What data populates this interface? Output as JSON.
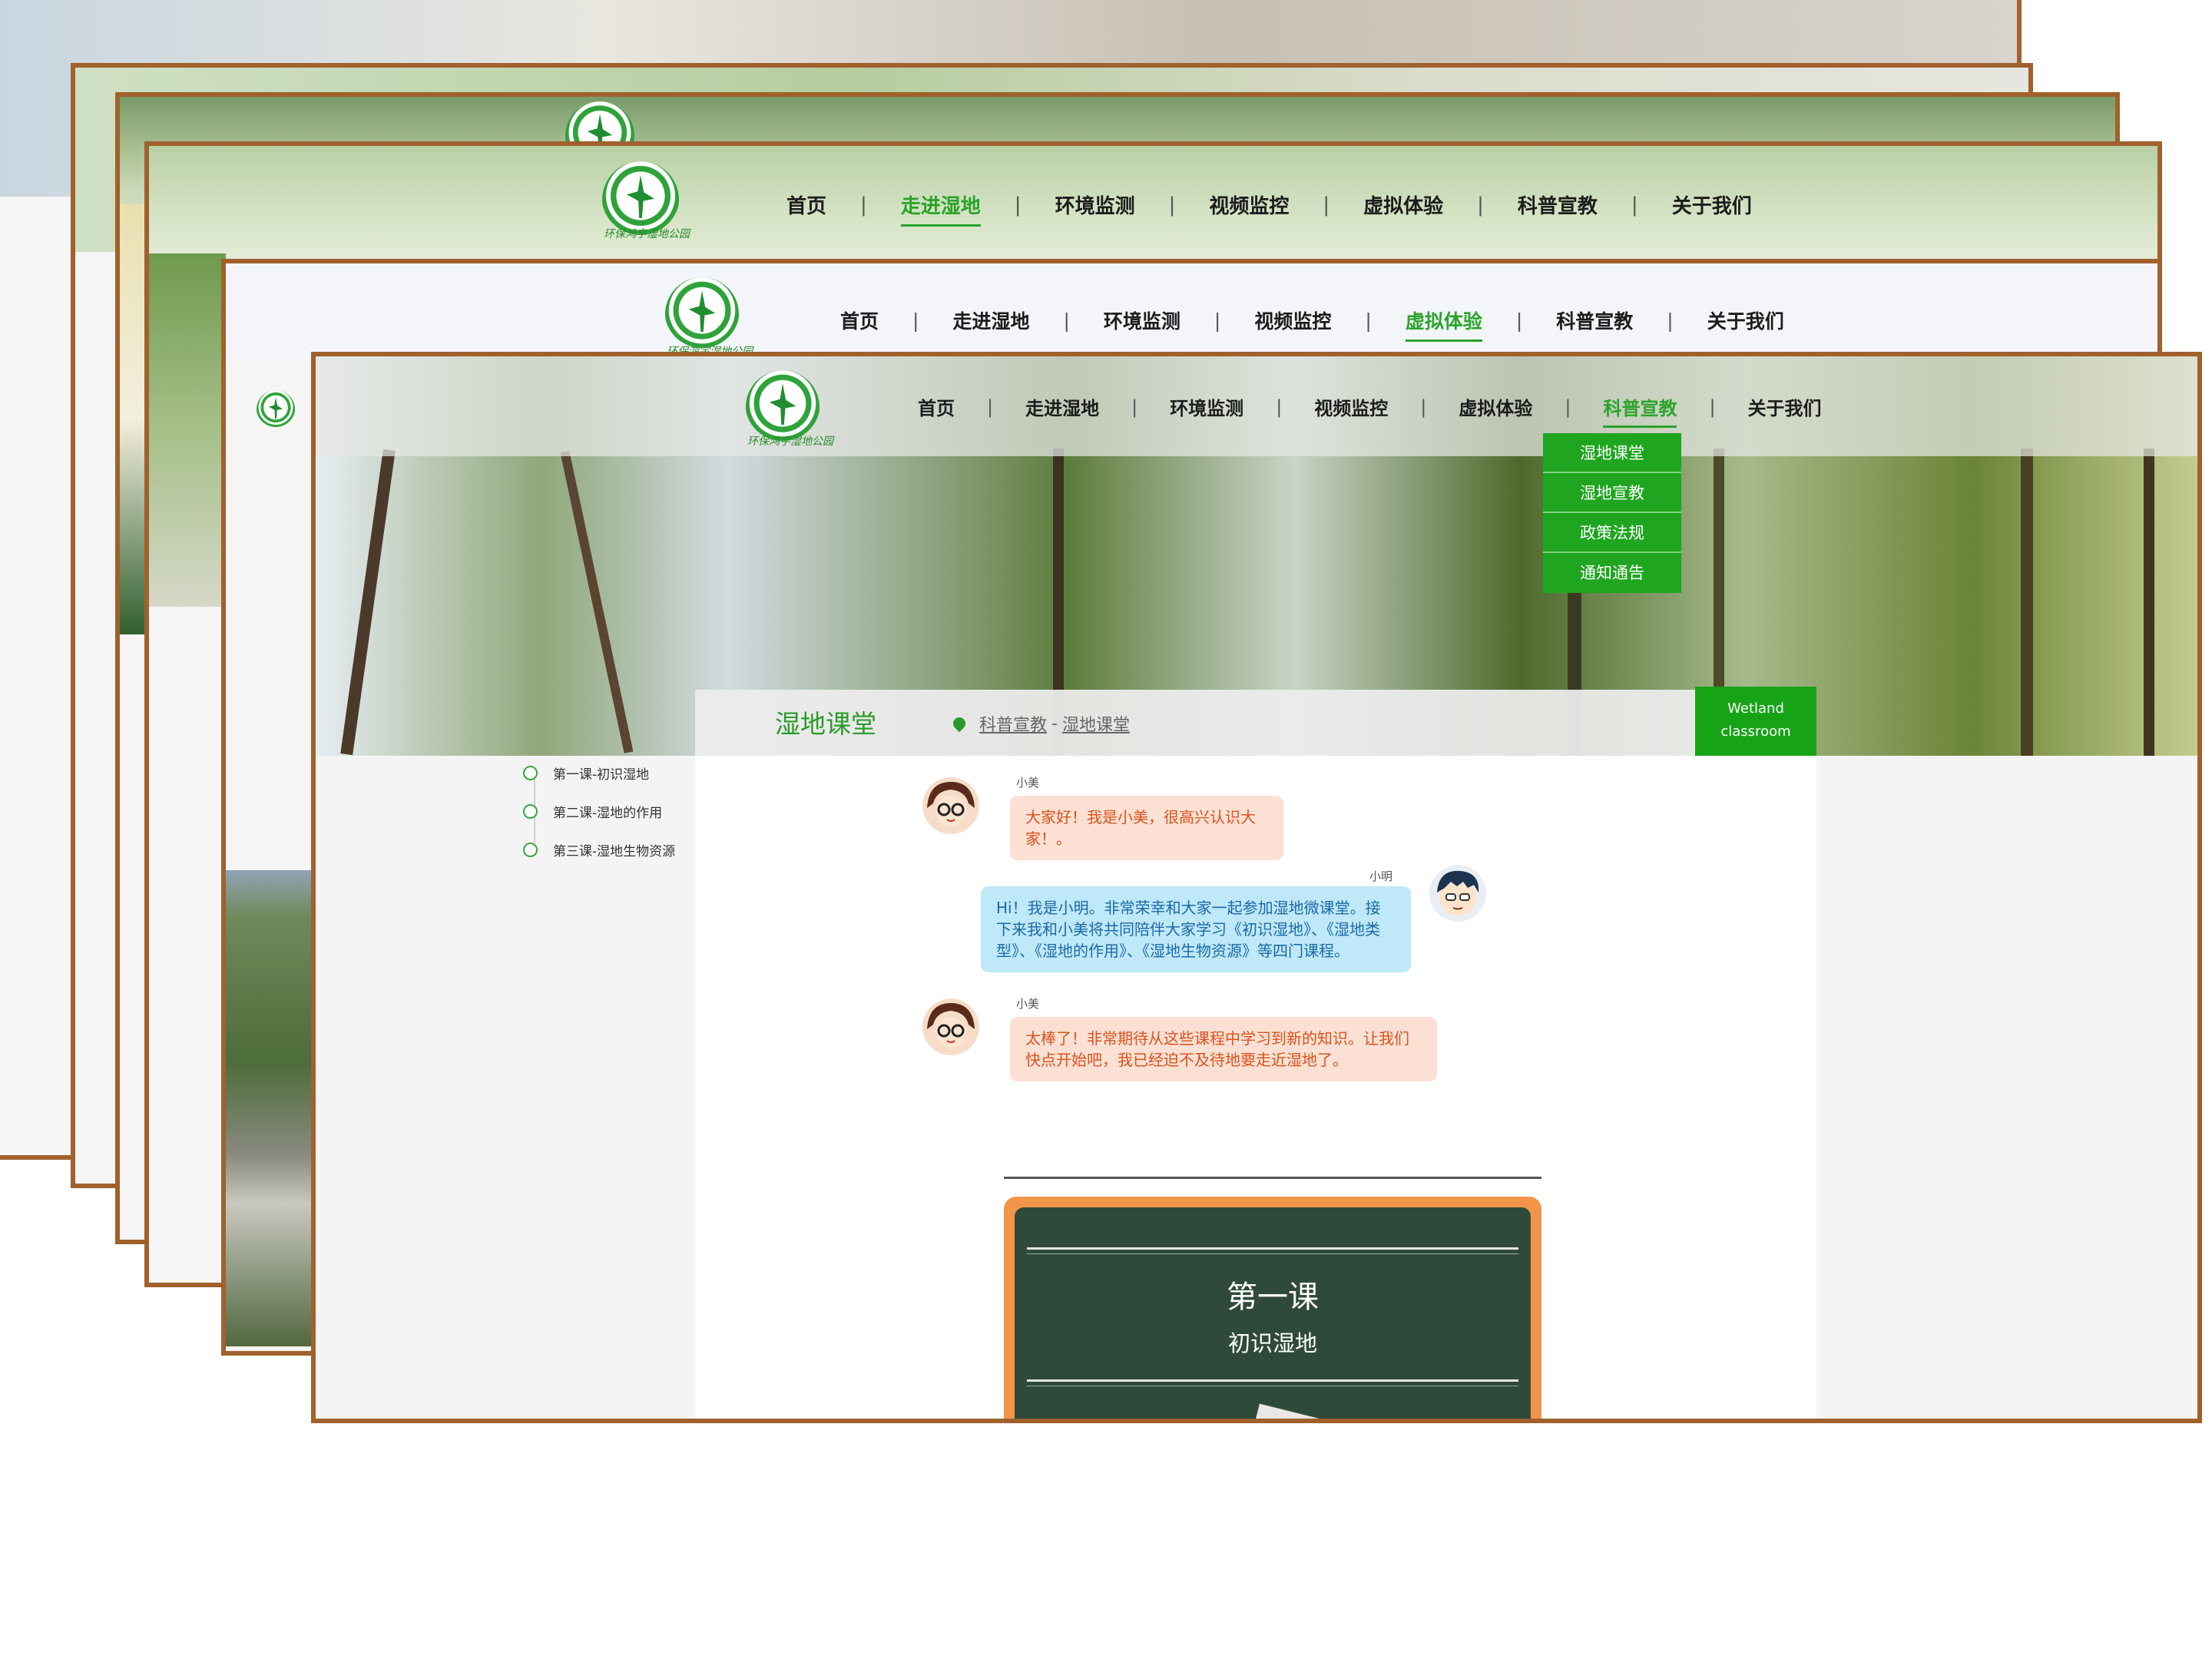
{
  "nav_items": [
    "首页",
    "走进湿地",
    "环境监测",
    "视频监控",
    "虚拟体验",
    "科普宣教",
    "关于我们"
  ],
  "nav_separator": "|",
  "logo_text": "环保鸿宇湿地公园",
  "front_page": {
    "active_nav": "科普宣教",
    "dropdown": [
      "湿地课堂",
      "湿地宣教",
      "政策法规",
      "通知通告"
    ],
    "section_title": "湿地课堂",
    "breadcrumb": {
      "parent": "科普宣教",
      "separator": "-",
      "current": "湿地课堂"
    },
    "badge": {
      "line1": "Wetland",
      "line2": "classroom"
    },
    "lessons": [
      "第一课-初识湿地",
      "第二课-湿地的作用",
      "第三课-湿地生物资源"
    ],
    "chat": [
      {
        "speaker": "小美",
        "role": "girl",
        "text": "大家好！我是小美，很高兴认识大家！。"
      },
      {
        "speaker": "小明",
        "role": "boy",
        "text": "Hi！我是小明。非常荣幸和大家一起参加湿地微课堂。接下来我和小美将共同陪伴大家学习《初识湿地》、《湿地类型》、《湿地的作用》、《湿地生物资源》等四门课程。"
      },
      {
        "speaker": "小美",
        "role": "girl",
        "text": "太棒了！非常期待从这些课程中学习到新的知识。让我们快点开始吧，我已经迫不及待地要走近湿地了。"
      }
    ],
    "blackboard": {
      "title": "第一课",
      "subtitle": "初识湿地"
    }
  },
  "page_virtual": {
    "active_nav": "虚拟体验"
  },
  "page_wetland": {
    "active_nav": "走进湿地"
  },
  "colors": {
    "frame": "#a0612c",
    "accent_green": "#2aa32a",
    "dropdown_green": "#1fa51f",
    "badge_green": "#16a316",
    "blackboard": "#2f4a3a"
  }
}
